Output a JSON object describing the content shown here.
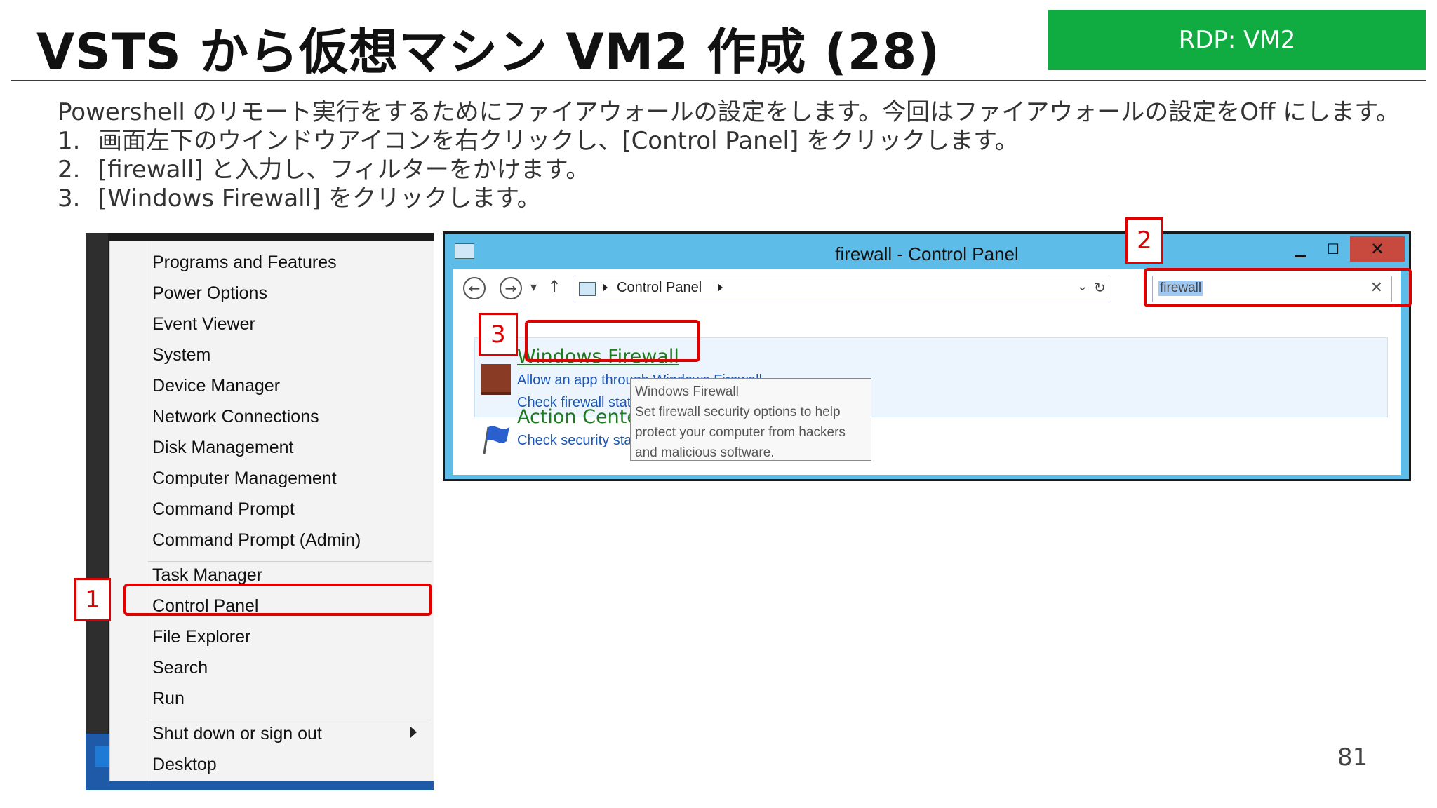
{
  "slide": {
    "title": "VSTS から仮想マシン VM2 作成 (28)",
    "badge": "RDP: VM2",
    "intro": "Powershell のリモート実行をするためにファイアウォールの設定をします。今回はファイアウォールの設定をOff にします。",
    "steps": [
      {
        "num": "1.",
        "text": "画面左下のウインドウアイコンを右クリックし、[Control Panel] をクリックします。"
      },
      {
        "num": "2.",
        "text": "[firewall] と入力し、フィルターをかけます。"
      },
      {
        "num": "3.",
        "text": "[Windows Firewall] をクリックします。"
      }
    ],
    "page_number": "81"
  },
  "power_menu": {
    "items": [
      "Programs and Features",
      "Power Options",
      "Event Viewer",
      "System",
      "Device Manager",
      "Network Connections",
      "Disk Management",
      "Computer Management",
      "Command Prompt",
      "Command Prompt (Admin)",
      "Task Manager",
      "Control Panel",
      "File Explorer",
      "Search",
      "Run",
      "Shut down or sign out",
      "Desktop"
    ],
    "highlighted": "Control Panel"
  },
  "control_panel": {
    "window_title": "firewall - Control Panel",
    "window_buttons": {
      "minimize": "▁",
      "maximize": "☐",
      "close": "✕"
    },
    "address": "Control Panel",
    "search_value": "firewall",
    "results": [
      {
        "title": "Windows Firewall",
        "links": [
          "Allow an app through Windows Firewall",
          "Check firewall status"
        ]
      },
      {
        "title": "Action Center",
        "links": [
          "Check security status"
        ]
      }
    ],
    "tooltip": [
      "Windows Firewall",
      "Set firewall security options to help",
      "protect your computer from hackers",
      "and malicious software."
    ]
  },
  "callouts": {
    "one": "1",
    "two": "2",
    "three": "3"
  },
  "colors": {
    "badge_green": "#10ab41",
    "callout_red": "#e00000",
    "window_blue": "#5ebce8",
    "link_green": "#1e7a1e",
    "link_blue": "#1a56b5"
  },
  "icons": [
    "back-arrow-icon",
    "forward-arrow-icon",
    "up-arrow-icon",
    "refresh-icon",
    "control-panel-icon",
    "firewall-icon",
    "action-center-flag-icon",
    "windows-start-icon"
  ]
}
